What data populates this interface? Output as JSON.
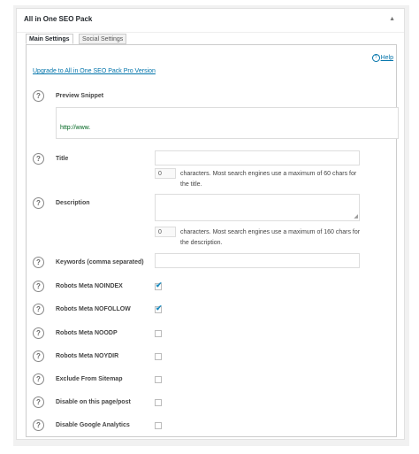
{
  "metabox": {
    "title": "All in One SEO Pack",
    "toggle_icon": "▲"
  },
  "tabs": [
    {
      "label": "Main Settings",
      "active": true
    },
    {
      "label": "Social Settings",
      "active": false
    }
  ],
  "help": {
    "label": "Help",
    "icon": "?"
  },
  "upgrade_link": "Upgrade to All in One SEO Pack Pro Version",
  "preview": {
    "label": "Preview Snippet",
    "url": "http://www."
  },
  "title_field": {
    "label": "Title",
    "value": "",
    "counter": "0",
    "note": "characters. Most search engines use a maximum of 60 chars for the title."
  },
  "description_field": {
    "label": "Description",
    "value": "",
    "counter": "0",
    "note": "characters. Most search engines use a maximum of 160 chars for the description."
  },
  "keywords_field": {
    "label": "Keywords (comma separated)",
    "value": ""
  },
  "checkboxes": [
    {
      "label": "Robots Meta NOINDEX",
      "checked": true
    },
    {
      "label": "Robots Meta NOFOLLOW",
      "checked": true
    },
    {
      "label": "Robots Meta NOODP",
      "checked": false
    },
    {
      "label": "Robots Meta NOYDIR",
      "checked": false
    },
    {
      "label": "Exclude From Sitemap",
      "checked": false
    },
    {
      "label": "Disable on this page/post",
      "checked": false
    },
    {
      "label": "Disable Google Analytics",
      "checked": false
    }
  ],
  "help_icon_glyph": "?",
  "check_glyph": "✔",
  "colors": {
    "link": "#0073aa",
    "check": "#1e8cbe",
    "snippet_url": "#006621"
  }
}
